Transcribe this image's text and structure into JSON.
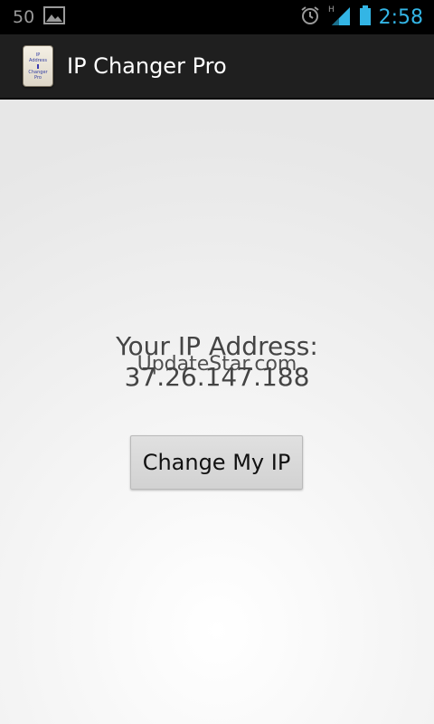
{
  "status_bar": {
    "notification_count": "50",
    "clock": "2:58",
    "icons": [
      "image-notification-icon",
      "alarm-icon",
      "signal-h-icon",
      "battery-icon"
    ],
    "clock_color": "#33b5e5"
  },
  "action_bar": {
    "title": "IP Changer Pro",
    "app_icon_text": [
      "IP",
      "Address",
      "Changer",
      "Pro"
    ]
  },
  "main": {
    "ip_label": "Your IP Address:",
    "ip_value": "37.26.147.188",
    "watermark": "UpdateStar.com",
    "change_button_label": "Change My IP"
  }
}
